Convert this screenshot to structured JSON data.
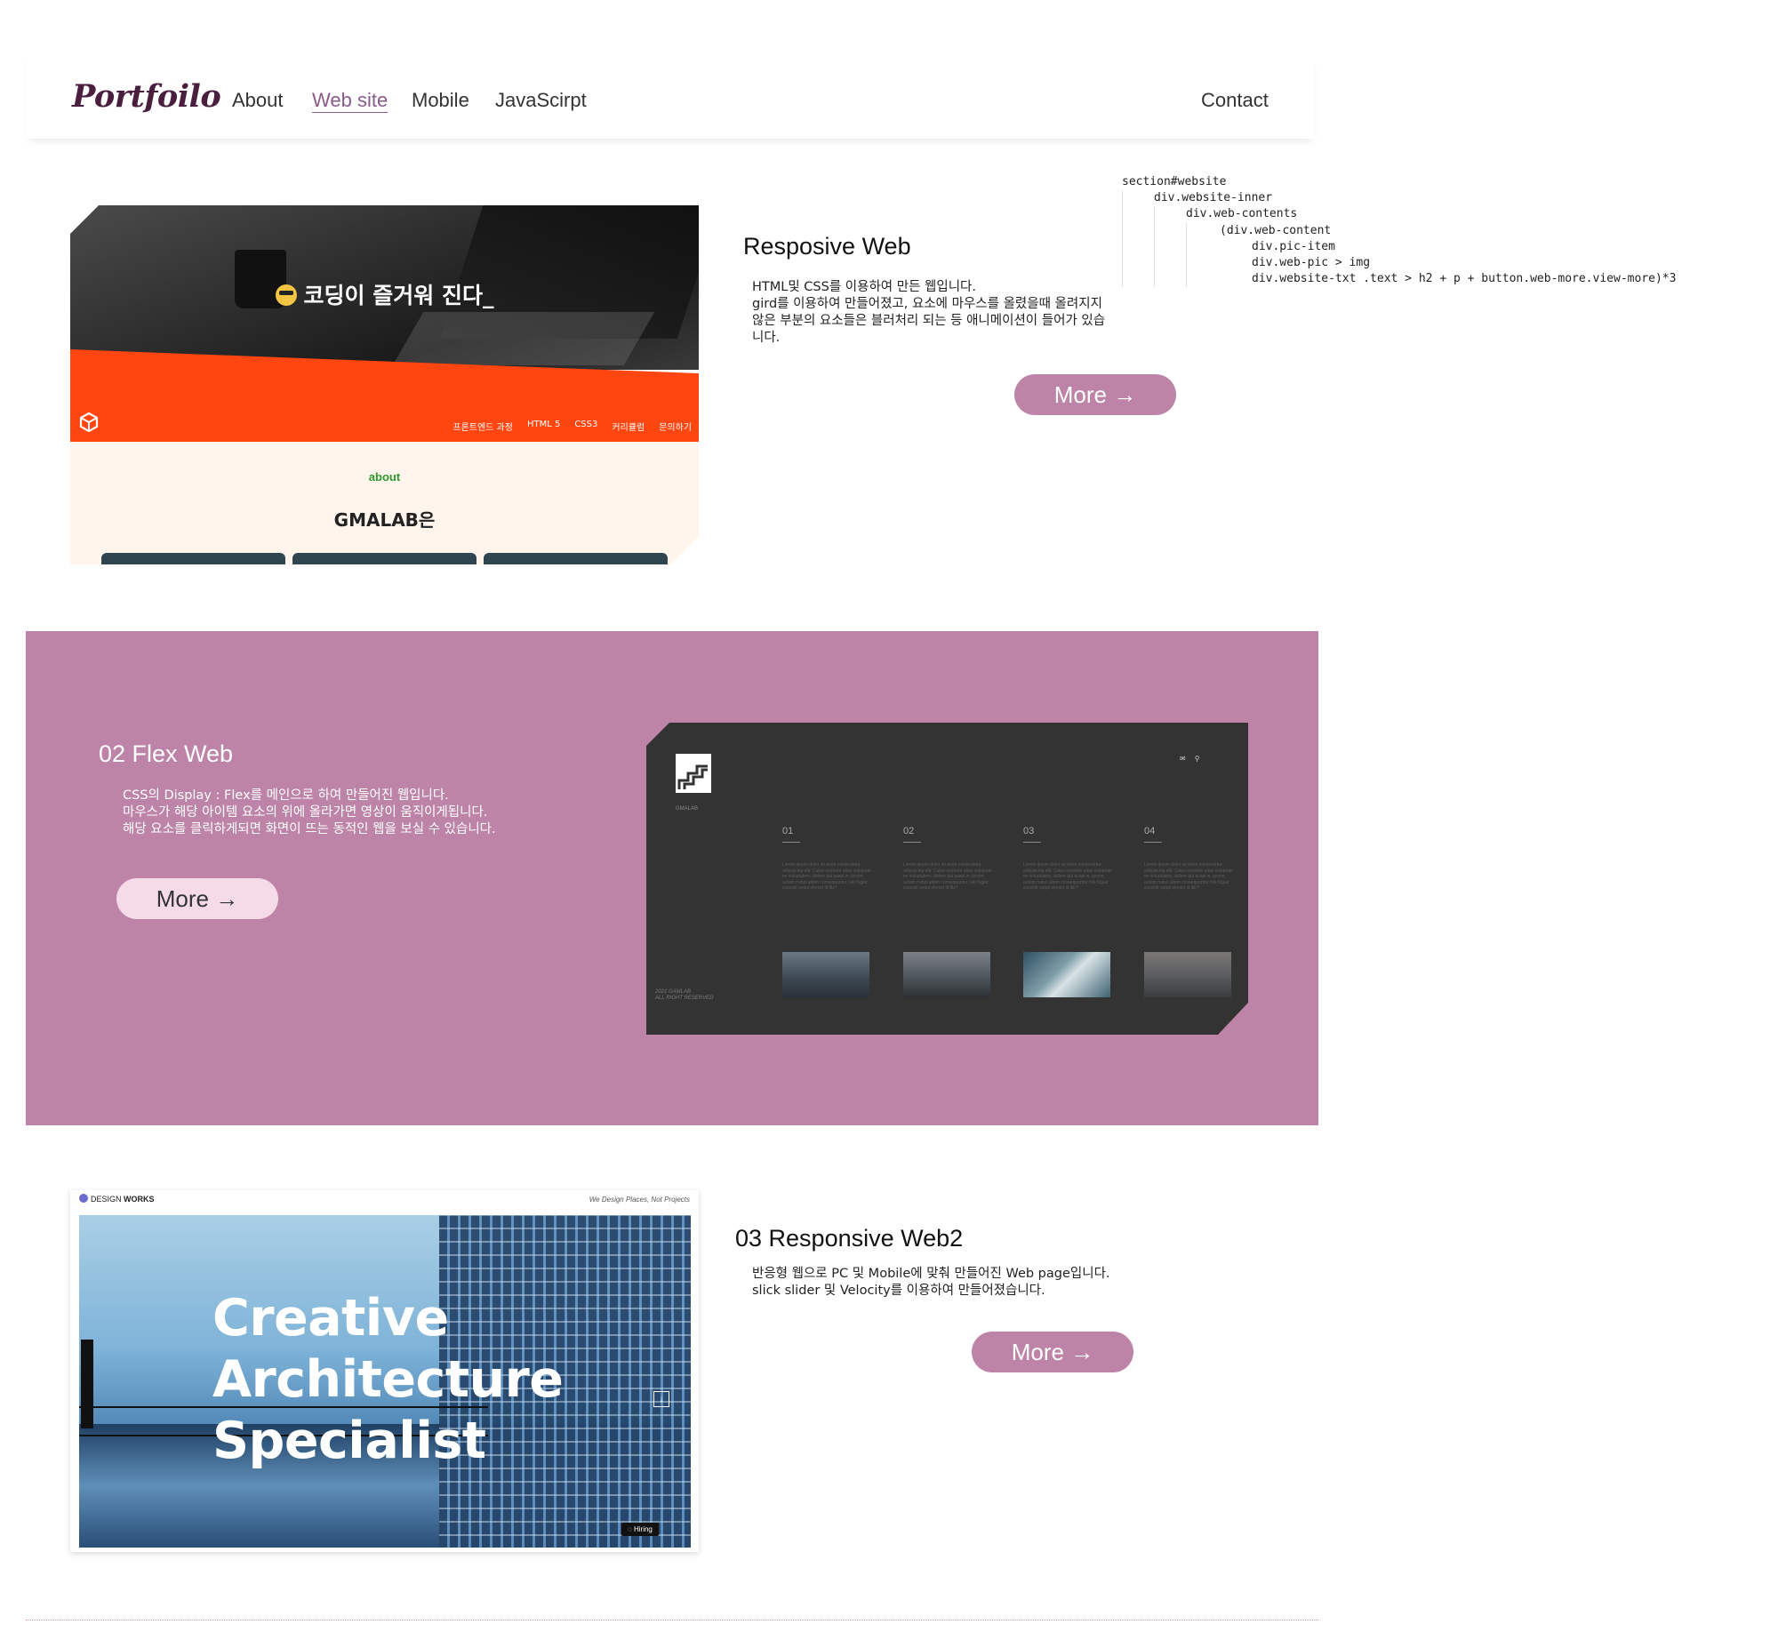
{
  "header": {
    "logo": "Portfoilo",
    "nav": [
      "About",
      "Web site",
      "Mobile",
      "JavaScirpt"
    ],
    "active_nav": "Web site",
    "contact": "Contact"
  },
  "code_snippet": [
    "section#website",
    "div.website-inner",
    "div.web-contents",
    "(div.web-content",
    "div.pic-item",
    "div.web-pic > img",
    "div.website-txt .text > h2 + p + button.web-more.view-more)*3"
  ],
  "section1": {
    "title": "Resposive Web",
    "description": "HTML및 CSS를 이용하여 만든 웹입니다.\ngird를 이용하여 만들어졌고, 요소에 마우스를 올렸을때 올려지지 않은 부분의 요소들은 블러처리 되는 등 애니메이션이 들어가 있습니다.",
    "more": "More →",
    "preview": {
      "hero_text": "코딩이 즐거워 진다_",
      "nav": [
        "프론트엔드 과정",
        "HTML 5",
        "CSS3",
        "커리큘럼",
        "문의하기"
      ],
      "section_label": "about",
      "section_title": "GMALAB은"
    }
  },
  "section2": {
    "title": "02 Flex Web",
    "description": "CSS의 Display : Flex를 메인으로 하여 만들어진 웹입니다.\n마우스가 해당 아이템 요소의 위에 올라가면 영상이 움직이게됩니다.\n해당 요소를 클릭하게되면 화면이 뜨는 동적인 웹을 보실 수 있습니다.",
    "more": "More →",
    "preview": {
      "brand": "GMALAB",
      "columns": [
        "01",
        "02",
        "03",
        "04"
      ],
      "lorem": "Lorem ipsum dolor sit amet consectetur, adipisicing elit. Culpa nostrum alias voluptate ex voluptatem, dolore qui quasi in, ipsum autem natus aliam consequuntur nile fugiat suscipit sequi eleniet id illo?",
      "footer": "2021 GAMLAB\nALL RIGHT RESERVED",
      "colors": [
        "#4f5a63",
        "#6a6f72",
        "#5f7f8d",
        "#565a60"
      ]
    }
  },
  "section3": {
    "title": "03 Responsive Web2",
    "description": "반응형 웹으로 PC 및 Mobile에 맞춰 만들어진 Web page입니다.\nslick slider 및 Velocity를 이용하여 만들어졌습니다.",
    "more": "More →",
    "preview": {
      "brand_prefix": "DESIGN",
      "brand_suffix": "WORKS",
      "tagline": "We Design Places, Not Projects",
      "headline": "Creative\nArchitecture\nSpecialist",
      "badge": "Hiring"
    }
  },
  "colors": {
    "accent": "#bd84a8",
    "band": "#bd84a8",
    "logo": "#4a1e3e",
    "orange": "#ff4510",
    "preview_dark": "#333333"
  }
}
